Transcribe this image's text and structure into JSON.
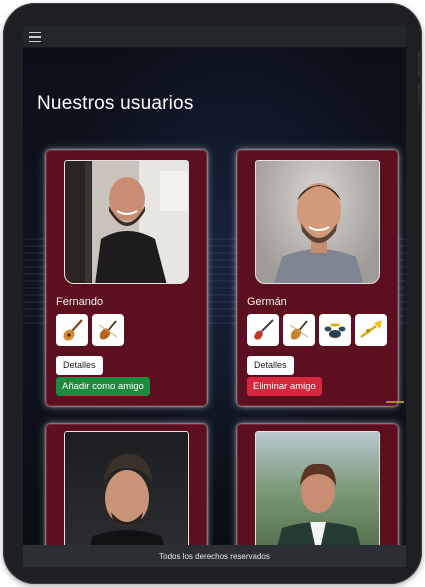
{
  "header": {
    "menu_icon": "hamburger-menu-icon"
  },
  "page": {
    "title": "Nuestros usuarios"
  },
  "users": [
    {
      "name": "Fernando",
      "instruments": [
        "acoustic-guitar-icon",
        "violin-icon"
      ],
      "details_label": "Detalles",
      "action_label": "Añadir como amigo",
      "action_color": "#1e8a3f"
    },
    {
      "name": "Germán",
      "instruments": [
        "electric-guitar-icon",
        "violin-icon",
        "drums-icon",
        "trumpet-icon"
      ],
      "details_label": "Detalles",
      "action_label": "Eliminar amigo",
      "action_color": "#d7263d"
    },
    {
      "name": "",
      "instruments": []
    },
    {
      "name": "",
      "instruments": []
    }
  ],
  "footer": {
    "text": "Todos los derechos reservados"
  },
  "colors": {
    "card_bg": "#5c0f1f",
    "add_button": "#1e8a3f",
    "remove_button": "#d7263d",
    "screen_bg": "#0c1018"
  }
}
